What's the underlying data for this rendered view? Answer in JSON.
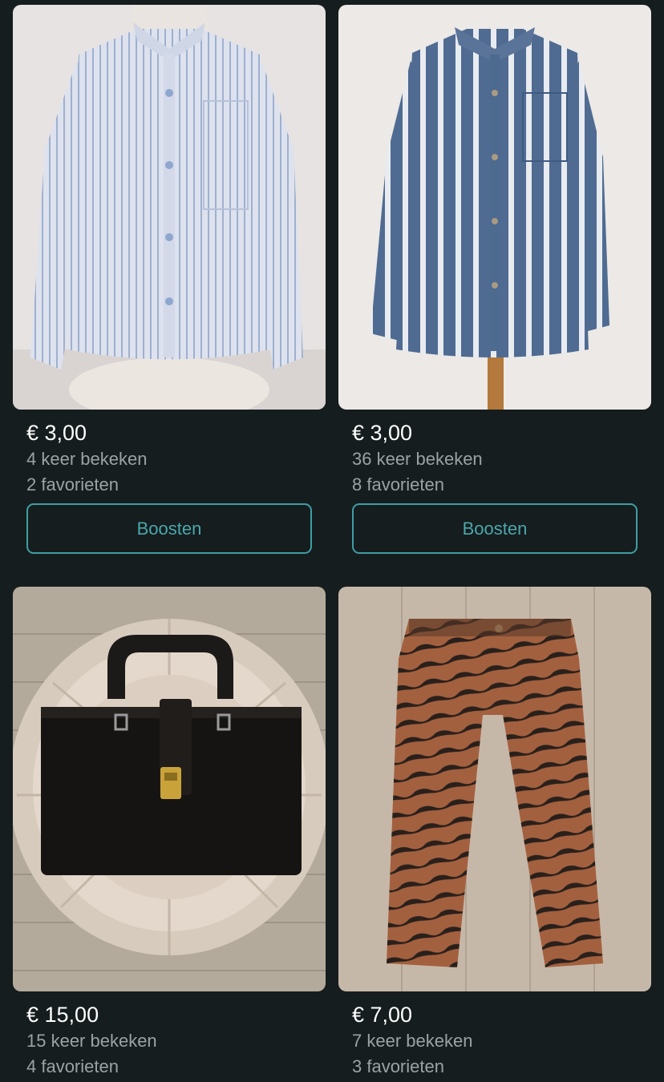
{
  "listings": [
    {
      "image_description_icon": "striped-light-blue-shirt",
      "price": "€ 3,00",
      "views": "4 keer bekeken",
      "favorites": "2 favorieten",
      "boost_label": "Boosten"
    },
    {
      "image_description_icon": "striped-navy-shirt",
      "price": "€ 3,00",
      "views": "36 keer bekeken",
      "favorites": "8 favorieten",
      "boost_label": "Boosten"
    },
    {
      "image_description_icon": "black-leather-handbag",
      "price": "€ 15,00",
      "views": "15 keer bekeken",
      "favorites": "4 favorieten"
    },
    {
      "image_description_icon": "zebra-print-jeans",
      "price": "€ 7,00",
      "views": "7 keer bekeken",
      "favorites": "3 favorieten"
    }
  ],
  "colors": {
    "background": "#161d1e",
    "accent": "#3e9ea3",
    "secondary_text": "#9aa3a4"
  }
}
